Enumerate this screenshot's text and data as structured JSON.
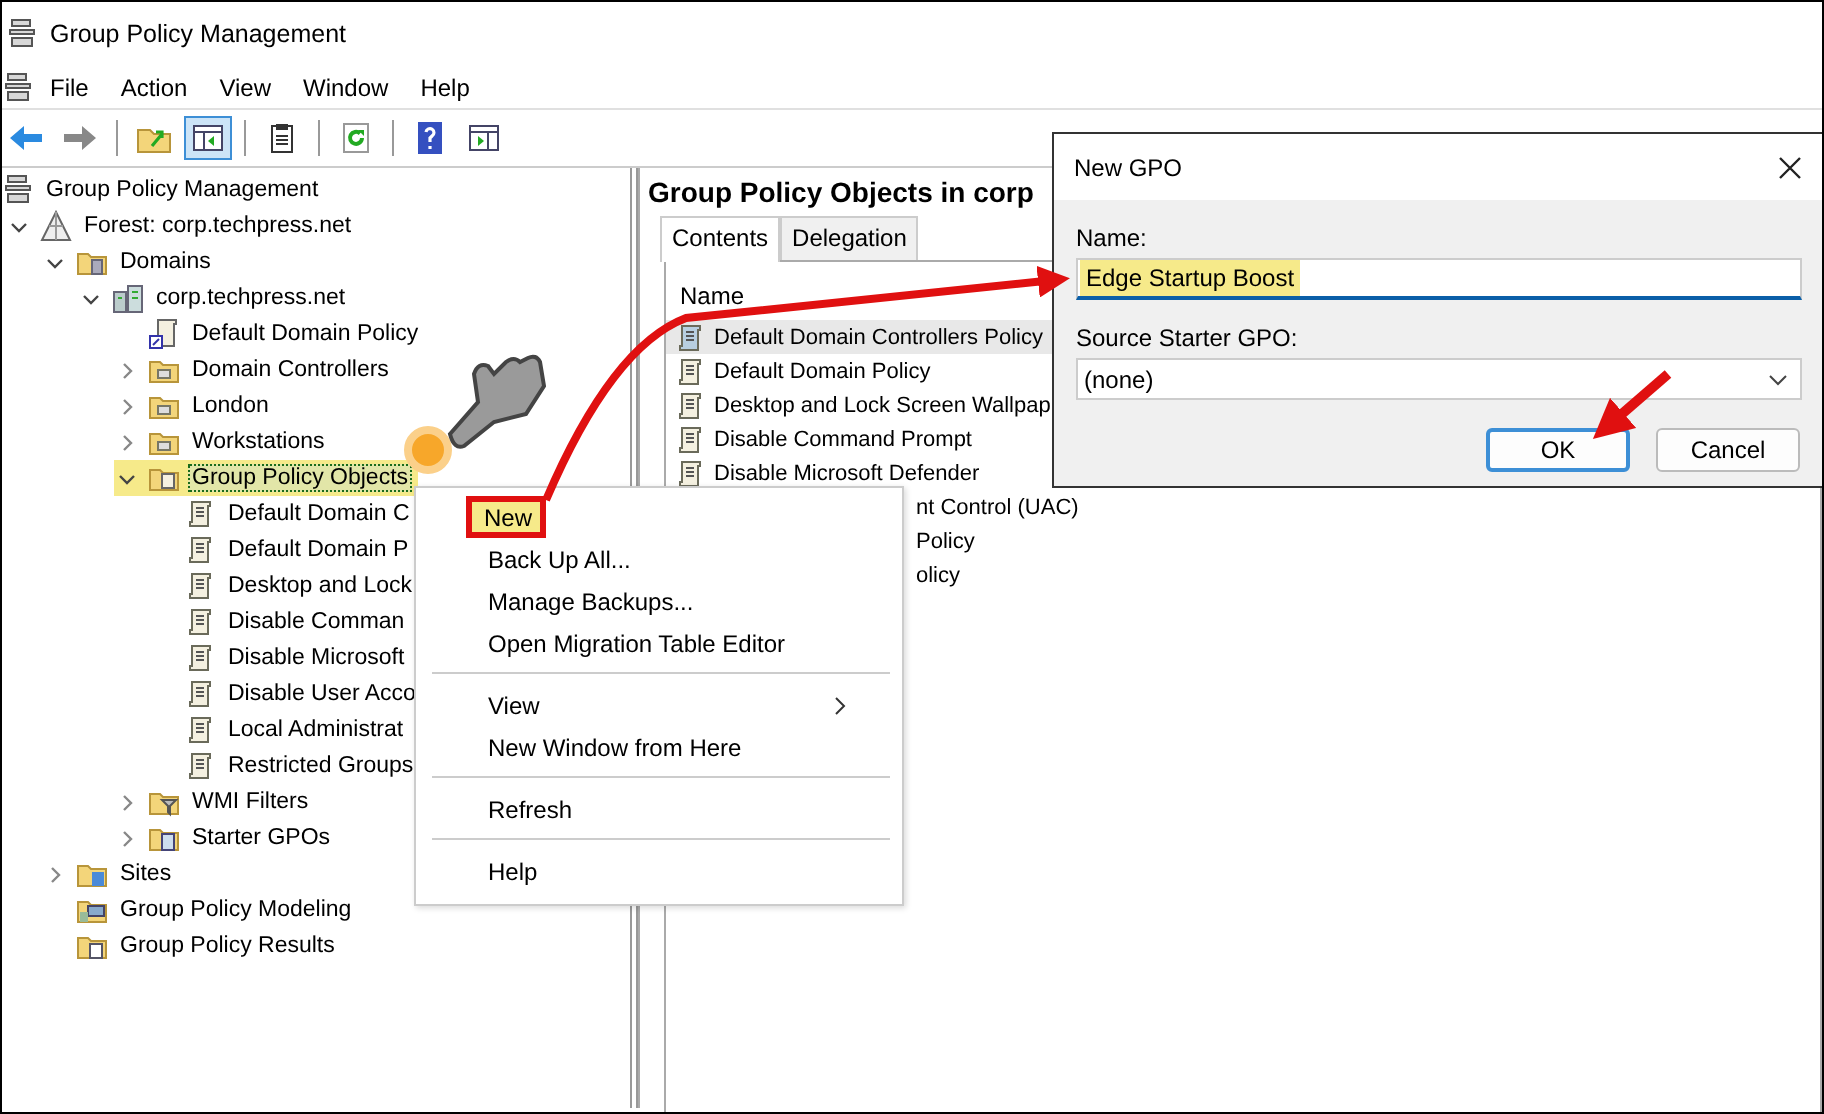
{
  "window": {
    "title": "Group Policy Management"
  },
  "menu_bar": [
    "File",
    "Action",
    "View",
    "Window",
    "Help"
  ],
  "toolbar": [
    {
      "kind": "back",
      "pressed": false
    },
    {
      "kind": "forward",
      "pressed": false
    },
    {
      "kind": "separator"
    },
    {
      "kind": "up",
      "pressed": false
    },
    {
      "kind": "console-tree",
      "pressed": true
    },
    {
      "kind": "separator"
    },
    {
      "kind": "properties",
      "pressed": false
    },
    {
      "kind": "separator"
    },
    {
      "kind": "refresh",
      "pressed": false
    },
    {
      "kind": "separator"
    },
    {
      "kind": "help",
      "pressed": false
    },
    {
      "kind": "action-pane",
      "pressed": false
    }
  ],
  "tree": [
    {
      "label": "Group Policy Management",
      "kind": "console",
      "selected": false,
      "children": [
        {
          "label": "Forest: corp.techpress.net",
          "kind": "forest",
          "expanded": true,
          "selected": false,
          "children": [
            {
              "label": "Domains",
              "kind": "domains",
              "expanded": true,
              "selected": false,
              "children": [
                {
                  "label": "corp.techpress.net",
                  "kind": "domain",
                  "expanded": true,
                  "selected": false,
                  "children": [
                    {
                      "label": "Default Domain Policy",
                      "kind": "link",
                      "selected": false
                    },
                    {
                      "label": "Domain Controllers",
                      "kind": "ou",
                      "expanded": false,
                      "selected": false
                    },
                    {
                      "label": "London",
                      "kind": "ou",
                      "expanded": false,
                      "selected": false
                    },
                    {
                      "label": "Workstations",
                      "kind": "ou",
                      "expanded": false,
                      "selected": false
                    },
                    {
                      "label": "Group Policy Objects",
                      "kind": "gpofolder",
                      "expanded": true,
                      "selected": true,
                      "children": [
                        {
                          "label": "Default Domain C",
                          "kind": "gpo",
                          "selected": false
                        },
                        {
                          "label": "Default Domain P",
                          "kind": "gpo",
                          "selected": false
                        },
                        {
                          "label": "Desktop and Lock",
                          "kind": "gpo",
                          "selected": false
                        },
                        {
                          "label": "Disable Comman",
                          "kind": "gpo",
                          "selected": false
                        },
                        {
                          "label": "Disable Microsoft",
                          "kind": "gpo",
                          "selected": false
                        },
                        {
                          "label": "Disable User Acco",
                          "kind": "gpo",
                          "selected": false
                        },
                        {
                          "label": "Local Administrat",
                          "kind": "gpo",
                          "selected": false
                        },
                        {
                          "label": "Restricted Groups",
                          "kind": "gpo",
                          "selected": false
                        }
                      ]
                    },
                    {
                      "label": "WMI Filters",
                      "kind": "wmi",
                      "expanded": false,
                      "selected": false
                    },
                    {
                      "label": "Starter GPOs",
                      "kind": "starter",
                      "expanded": false,
                      "selected": false
                    }
                  ]
                }
              ]
            },
            {
              "label": "Sites",
              "kind": "sites",
              "expanded": false,
              "selected": false
            },
            {
              "label": "Group Policy Modeling",
              "kind": "modeling",
              "selected": false
            },
            {
              "label": "Group Policy Results",
              "kind": "results",
              "selected": false
            }
          ]
        }
      ]
    }
  ],
  "content": {
    "title": "Group Policy Objects in corp",
    "tabs": [
      {
        "label": "Contents",
        "selected": true
      },
      {
        "label": "Delegation",
        "selected": false
      }
    ],
    "column": "Name",
    "rows": [
      {
        "name": "Default Domain Controllers Policy",
        "kind": "full",
        "selected": true
      },
      {
        "name": "Default Domain Policy",
        "kind": "full",
        "selected": false
      },
      {
        "name": "Desktop and Lock Screen Wallpap",
        "kind": "full",
        "selected": false
      },
      {
        "name": "Disable Command Prompt",
        "kind": "full",
        "selected": false
      },
      {
        "name": "Disable Microsoft Defender",
        "kind": "full",
        "selected": false
      },
      {
        "name": "nt Control (UAC)",
        "kind": "partial",
        "selected": false
      },
      {
        "name": "Policy",
        "kind": "partial",
        "selected": false
      },
      {
        "name": "olicy",
        "kind": "partial",
        "selected": false
      }
    ]
  },
  "context_menu": [
    {
      "kind": "item",
      "label": "New",
      "selected": true,
      "submenu": false
    },
    {
      "kind": "item",
      "label": "Back Up All...",
      "selected": false,
      "submenu": false
    },
    {
      "kind": "item",
      "label": "Manage Backups...",
      "selected": false,
      "submenu": false
    },
    {
      "kind": "item",
      "label": "Open Migration Table Editor",
      "selected": false,
      "submenu": false
    },
    {
      "kind": "separator"
    },
    {
      "kind": "item",
      "label": "View",
      "selected": false,
      "submenu": true
    },
    {
      "kind": "item",
      "label": "New Window from Here",
      "selected": false,
      "submenu": false
    },
    {
      "kind": "separator"
    },
    {
      "kind": "item",
      "label": "Refresh",
      "selected": false,
      "submenu": false
    },
    {
      "kind": "separator"
    },
    {
      "kind": "item",
      "label": "Help",
      "selected": false,
      "submenu": false
    }
  ],
  "dialog": {
    "title": "New GPO",
    "name_label": "Name:",
    "name_value": "Edge Startup Boost",
    "name_highlighted": true,
    "source_label": "Source Starter GPO:",
    "source_value": "(none)",
    "buttons": [
      {
        "label": "OK",
        "default": true
      },
      {
        "label": "Cancel",
        "default": false
      }
    ]
  }
}
